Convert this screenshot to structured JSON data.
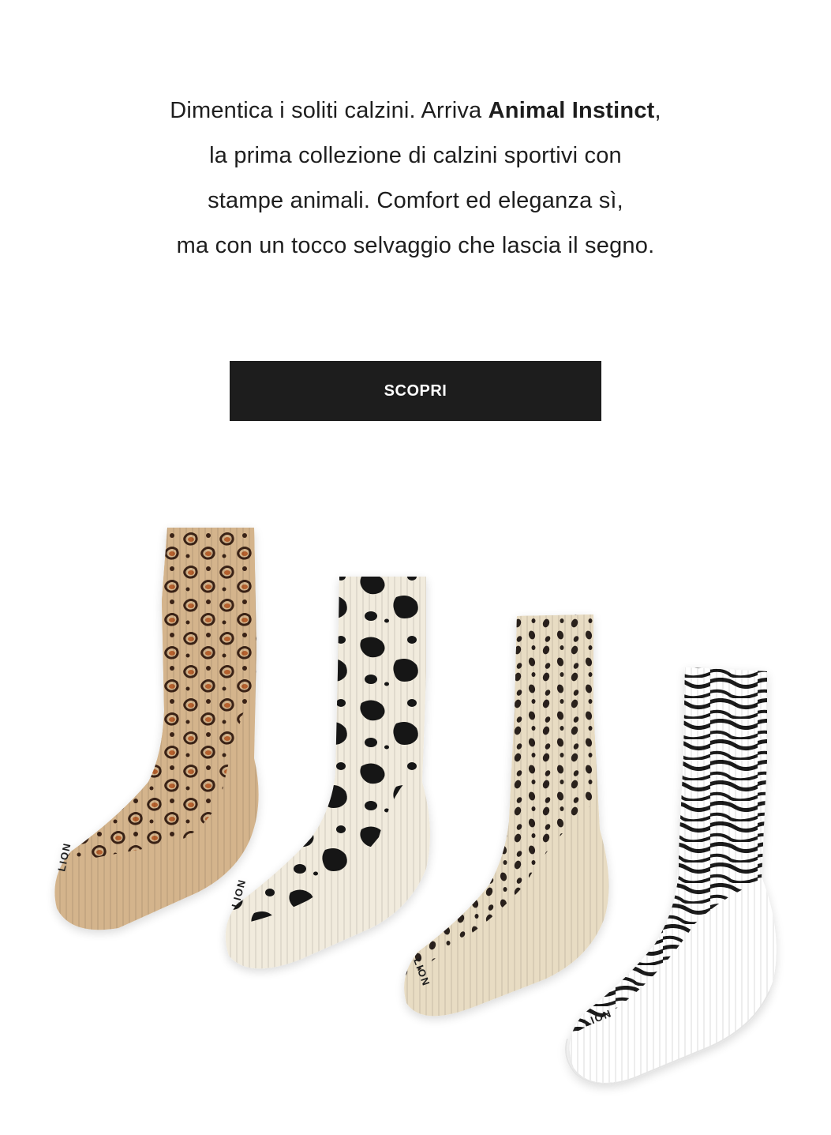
{
  "intro": {
    "line1_start": "Dimentica i soliti calzini. Arriva ",
    "line1_bold": "Animal Instinct",
    "line1_end": ",",
    "line2": "la prima collezione di calzini sportivi con",
    "line3": "stampe animali. Comfort ed eleganza sì,",
    "line4": "ma con un tocco selvaggio che lascia il segno."
  },
  "cta": {
    "label": "SCOPRI"
  },
  "products": {
    "socks": [
      {
        "pattern": "leopard",
        "base_color": "#d4b48c",
        "spot_color": "#3a2418",
        "accent_color": "#b5612e",
        "brand": "LION"
      },
      {
        "pattern": "cow",
        "base_color": "#f1ebdd",
        "spot_color": "#141414",
        "brand": "LION"
      },
      {
        "pattern": "dalmatian",
        "base_color": "#e8dcc3",
        "spot_color": "#2a211c",
        "brand": "LION"
      },
      {
        "pattern": "zebra",
        "base_color": "#ffffff",
        "spot_color": "#1a1a1a",
        "brand": "LION"
      }
    ]
  }
}
